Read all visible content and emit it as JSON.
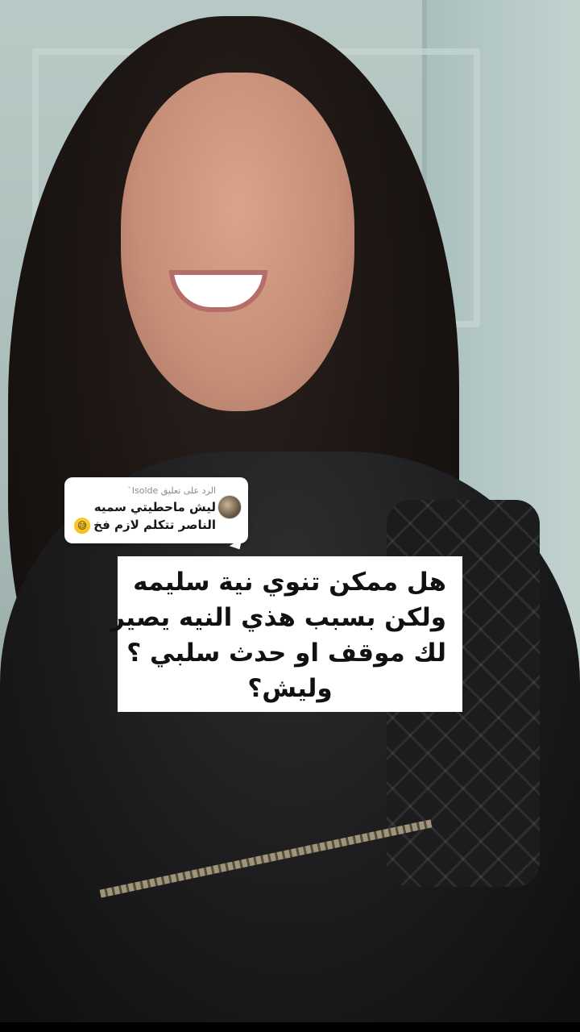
{
  "reply_comment": {
    "header": "الرد على تعليق Isolde`",
    "text_line1": "ليش ماحطيتي سميه",
    "text_line2": "الناصر تتكلم لازم فخ",
    "emoji": "😅",
    "avatar_icon": "user-avatar-icon"
  },
  "caption": {
    "line1": "هل ممكن تنوي نية سليمه",
    "line2": "ولكن بسبب هذي النيه يصير",
    "line3": "لك موقف او حدث سلبي ؟",
    "line4": "وليش؟"
  },
  "colors": {
    "bubble_bg": "#ffffff",
    "caption_bg": "#ffffff",
    "text": "#111111"
  }
}
